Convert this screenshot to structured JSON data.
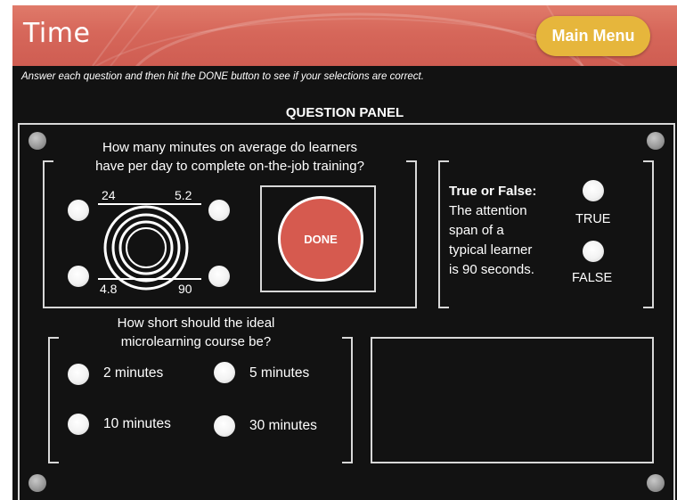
{
  "header": {
    "title": "Time",
    "main_menu_label": "Main Menu"
  },
  "instructions": "Answer each question and then hit the DONE button to see if your selections are correct.",
  "panel_title": "QUESTION PANEL",
  "question1": {
    "text_line1": "How many minutes on average do learners",
    "text_line2": "have per day to complete on-the-job training?",
    "options": [
      "24",
      "5.2",
      "4.8",
      "90"
    ]
  },
  "done_button_label": "DONE",
  "true_false": {
    "heading": "True or False:",
    "line1": "The attention",
    "line2": "span of a",
    "line3": "typical learner",
    "line4": "is 90 seconds.",
    "true_label": "TRUE",
    "false_label": "FALSE"
  },
  "question2": {
    "text_line1": "How short should the ideal",
    "text_line2": "microlearning course be?",
    "options": [
      "2 minutes",
      "5 minutes",
      "10 minutes",
      "30 minutes"
    ]
  },
  "colors": {
    "header": "#d6675a",
    "main_menu": "#e6b63c",
    "done_button": "#d65a4f",
    "panel_background": "#121212"
  }
}
